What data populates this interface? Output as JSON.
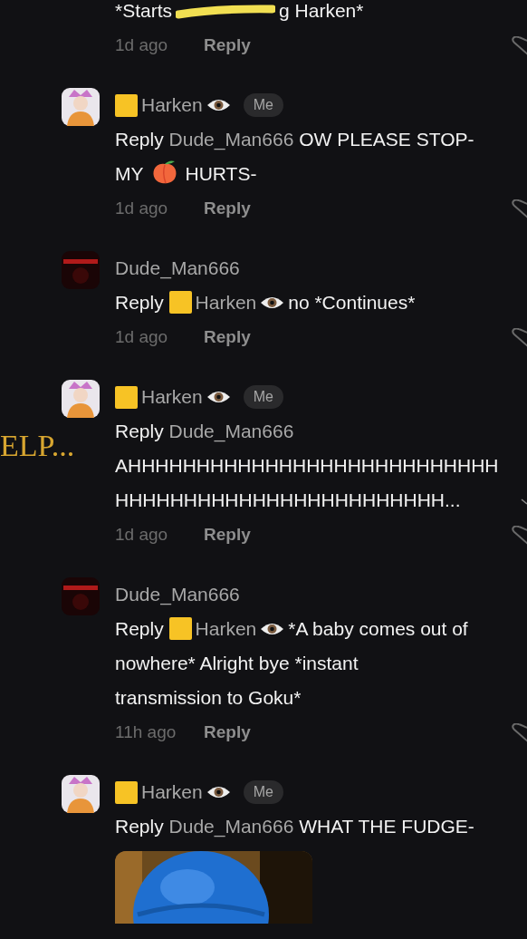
{
  "top_comment": {
    "parts": [
      {
        "kind": "text",
        "text": "*Starts"
      },
      {
        "kind": "scribble"
      },
      {
        "kind": "text",
        "text": "g Harken*"
      }
    ],
    "time": "1d ago",
    "reply": "Reply"
  },
  "comments": [
    {
      "author": {
        "name": "Harken",
        "kind": "tagged"
      },
      "badge": "Me",
      "avatar": {
        "kind": "light"
      },
      "reply_word": "Reply",
      "mention": {
        "name": "Dude_Man666",
        "kind": "plain"
      },
      "first_line": [
        {
          "kind": "text",
          "text": "OW PLEASE STOP-"
        }
      ],
      "more_lines": [
        [
          {
            "kind": "text",
            "text": "MY"
          },
          {
            "kind": "peach"
          },
          {
            "kind": "text",
            "text": "HURTS-"
          }
        ]
      ],
      "time": "1d ago",
      "reply": "Reply"
    },
    {
      "author": {
        "name": "Dude_Man666",
        "kind": "plain"
      },
      "avatar": {
        "kind": "dark"
      },
      "reply_word": "Reply",
      "mention": {
        "name": "Harken",
        "kind": "tagged"
      },
      "first_line": [
        {
          "kind": "text",
          "text": "no *Continues*"
        }
      ],
      "time": "1d ago",
      "reply": "Reply"
    },
    {
      "author": {
        "name": "Harken",
        "kind": "tagged"
      },
      "badge": "Me",
      "avatar": {
        "kind": "light"
      },
      "overlay_text": "ELP...",
      "reply_word": "Reply",
      "mention": {
        "name": "Dude_Man666",
        "kind": "plain"
      },
      "more_lines": [
        [
          {
            "kind": "text",
            "text": "AHHHHHHHHHHHHHHHHHHHHHHHHHHH"
          }
        ],
        [
          {
            "kind": "text",
            "text": "HHHHHHHHHHHHHHHHHHHHHHHH..."
          }
        ]
      ],
      "expandable": true,
      "time": "1d ago",
      "reply": "Reply"
    },
    {
      "author": {
        "name": "Dude_Man666",
        "kind": "plain"
      },
      "avatar": {
        "kind": "dark"
      },
      "reply_word": "Reply",
      "mention": {
        "name": "Harken",
        "kind": "tagged"
      },
      "first_line": [
        {
          "kind": "text",
          "text": "*A baby comes out of"
        }
      ],
      "more_lines": [
        [
          {
            "kind": "text",
            "text": "nowhere* Alright bye *instant"
          }
        ],
        [
          {
            "kind": "text",
            "text": "transmission to Goku*"
          }
        ]
      ],
      "time": "11h ago",
      "reply": "Reply"
    },
    {
      "author": {
        "name": "Harken",
        "kind": "tagged"
      },
      "badge": "Me",
      "avatar": {
        "kind": "light"
      },
      "reply_word": "Reply",
      "mention": {
        "name": "Dude_Man666",
        "kind": "plain"
      },
      "first_line": [
        {
          "kind": "text",
          "text": "WHAT THE FUDGE-"
        }
      ],
      "attachment": {
        "kind": "picture"
      }
    }
  ]
}
